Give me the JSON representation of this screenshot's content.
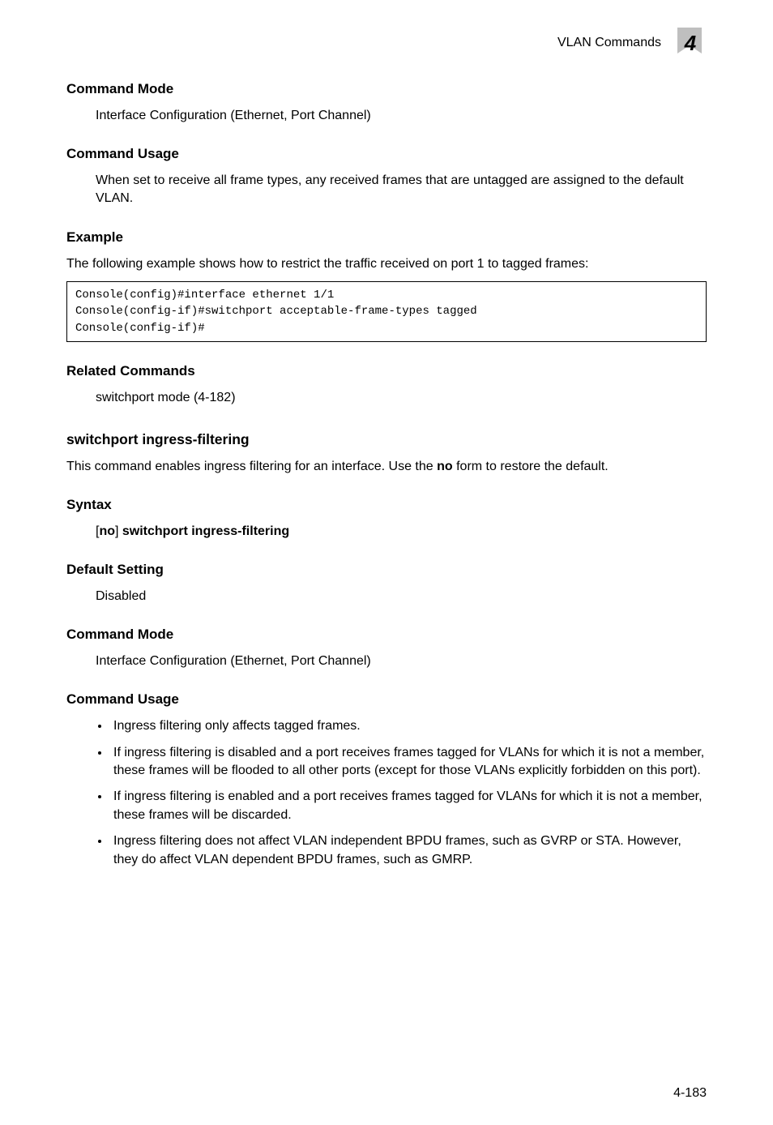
{
  "running": {
    "title": "VLAN Commands",
    "chapter_num": "4"
  },
  "sec1": {
    "heading": "Command Mode",
    "para1": "Interface Configuration (Ethernet, Port Channel)"
  },
  "sec2": {
    "heading": "Command Usage",
    "para1": "When set to receive all frame types, any received frames that are untagged are assigned to the default VLAN."
  },
  "sec3": {
    "heading": "Example",
    "para1": "The following example shows how to restrict the traffic received on port 1 to tagged frames:"
  },
  "code1": "Console(config)#interface ethernet 1/1\nConsole(config-if)#switchport acceptable-frame-types tagged\nConsole(config-if)#",
  "sec4": {
    "heading": "Related Commands",
    "para1": "switchport mode (4-182)"
  },
  "sub": {
    "title": "switchport ingress-filtering",
    "intro_before_bold": "This command enables ingress filtering for an interface. Use the ",
    "intro_bold": "no",
    "intro_after_bold": " form to restore the default."
  },
  "sec5": {
    "heading": "Syntax",
    "line_open": "[",
    "line_no": "no",
    "line_close": "] ",
    "line_cmd": "switchport ingress-filtering"
  },
  "sec6": {
    "heading": "Default Setting",
    "para1": "Disabled"
  },
  "sec7": {
    "heading": "Command Mode",
    "para1": "Interface Configuration (Ethernet, Port Channel)"
  },
  "sec8": {
    "heading": "Command Usage",
    "bullets": {
      "0": "Ingress filtering only affects tagged frames.",
      "1": "If ingress filtering is disabled and a port receives frames tagged for VLANs for which it is not a member, these frames will be flooded to all other ports (except for those VLANs explicitly forbidden on this port).",
      "2": "If ingress filtering is enabled and a port receives frames tagged for VLANs for which it is not a member, these frames will be discarded.",
      "3": "Ingress filtering does not affect VLAN independent BPDU frames, such as GVRP or STA. However, they do affect VLAN dependent BPDU frames, such as GMRP."
    }
  },
  "pagenum": "4-183"
}
